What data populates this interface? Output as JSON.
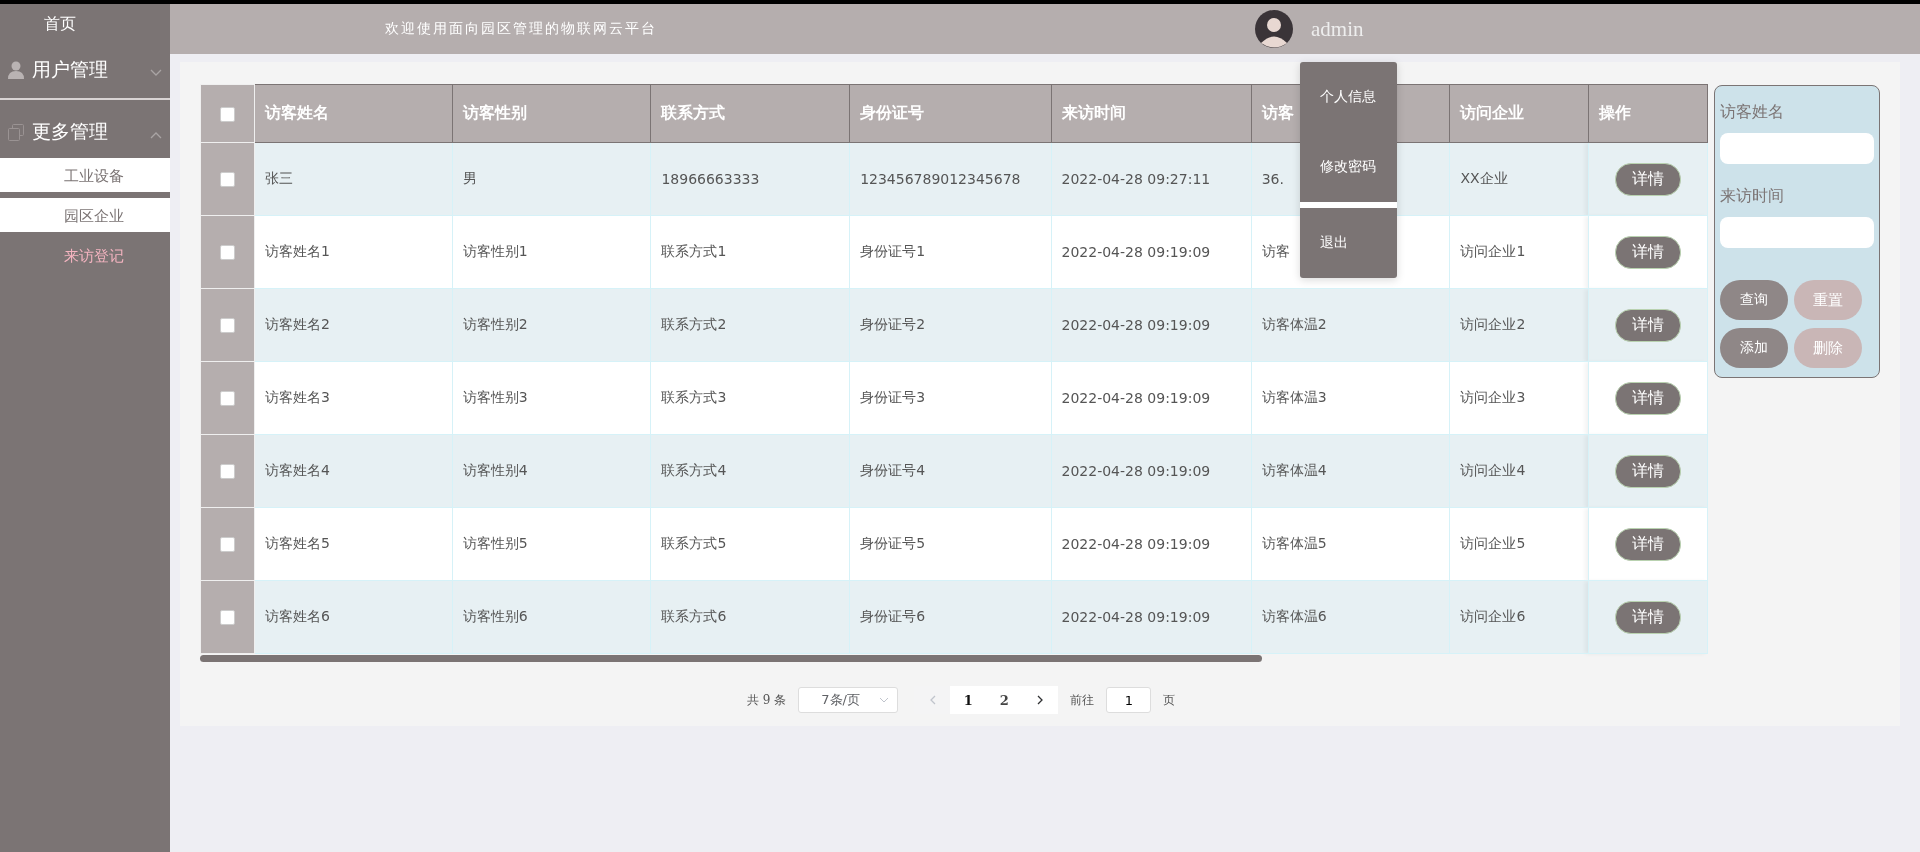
{
  "sidebar": {
    "home": "首页",
    "groups": [
      {
        "label": "用户管理",
        "expanded": false
      },
      {
        "label": "更多管理",
        "expanded": true,
        "items": [
          {
            "label": "工业设备",
            "selected": false
          },
          {
            "label": "园区企业",
            "selected": false
          },
          {
            "label": "来访登记",
            "selected": true
          }
        ]
      }
    ]
  },
  "header": {
    "title": "欢迎使用面向园区管理的物联网云平台",
    "user": "admin"
  },
  "user_menu": {
    "items": [
      "个人信息",
      "修改密码",
      "退出"
    ]
  },
  "table": {
    "select_all": {
      "checked": false
    },
    "columns": [
      "访客姓名",
      "访客性别",
      "联系方式",
      "身份证号",
      "来访时间",
      "访客",
      "访问企业",
      "操作"
    ],
    "rows": [
      {
        "checked": false,
        "cells": [
          "张三",
          "男",
          "18966663333",
          "123456789012345678",
          "2022-04-28 09:27:11",
          "36.",
          "XX企业"
        ],
        "action": "详情"
      },
      {
        "checked": false,
        "cells": [
          "访客姓名1",
          "访客性别1",
          "联系方式1",
          "身份证号1",
          "2022-04-28 09:19:09",
          "访客",
          "访问企业1"
        ],
        "action": "详情"
      },
      {
        "checked": false,
        "cells": [
          "访客姓名2",
          "访客性别2",
          "联系方式2",
          "身份证号2",
          "2022-04-28 09:19:09",
          "访客体温2",
          "访问企业2"
        ],
        "action": "详情"
      },
      {
        "checked": false,
        "cells": [
          "访客姓名3",
          "访客性别3",
          "联系方式3",
          "身份证号3",
          "2022-04-28 09:19:09",
          "访客体温3",
          "访问企业3"
        ],
        "action": "详情"
      },
      {
        "checked": false,
        "cells": [
          "访客姓名4",
          "访客性别4",
          "联系方式4",
          "身份证号4",
          "2022-04-28 09:19:09",
          "访客体温4",
          "访问企业4"
        ],
        "action": "详情"
      },
      {
        "checked": false,
        "cells": [
          "访客姓名5",
          "访客性别5",
          "联系方式5",
          "身份证号5",
          "2022-04-28 09:19:09",
          "访客体温5",
          "访问企业5"
        ],
        "action": "详情"
      },
      {
        "checked": false,
        "cells": [
          "访客姓名6",
          "访客性别6",
          "联系方式6",
          "身份证号6",
          "2022-04-28 09:19:09",
          "访客体温6",
          "访问企业6"
        ],
        "action": "详情"
      }
    ]
  },
  "pagination": {
    "total": "共 9 条",
    "page_size": "7条/页",
    "pages": [
      {
        "label": "1",
        "selected": true
      },
      {
        "label": "2",
        "selected": false
      }
    ],
    "goto_label": "前往",
    "goto_value": "1",
    "page_suffix": "页"
  },
  "filter": {
    "fields": [
      {
        "label": "访客姓名"
      },
      {
        "label": "来访时间"
      }
    ],
    "buttons": [
      {
        "label": "查询",
        "disabled": false
      },
      {
        "label": "重置",
        "disabled": true
      },
      {
        "label": "添加",
        "disabled": false
      },
      {
        "label": "删除",
        "disabled": true
      }
    ]
  }
}
